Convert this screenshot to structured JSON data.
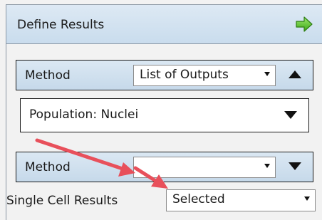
{
  "panel": {
    "title": "Define Results",
    "go_icon": "green-right-arrow-icon"
  },
  "method_1": {
    "label": "Method",
    "selected": "List of Outputs",
    "collapse_icon": "triangle-up-icon"
  },
  "population": {
    "text": "Population: Nuclei",
    "dropdown_icon": "triangle-down-icon"
  },
  "method_2": {
    "label": "Method",
    "selected": "",
    "expand_icon": "triangle-down-icon"
  },
  "single_cell_results": {
    "label": "Single Cell Results",
    "selected": "Selected"
  },
  "colors": {
    "header_gradient_top": "#dde9f4",
    "header_gradient_bottom": "#c9dced",
    "go_arrow_green": "#5cc12b",
    "annotation_red": "#e8505b"
  }
}
